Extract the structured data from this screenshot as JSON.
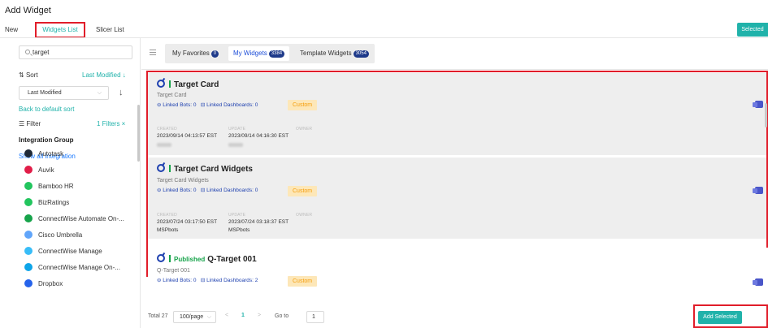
{
  "window": {
    "title": "Add Widget"
  },
  "top_tabs": [
    {
      "label": "New"
    },
    {
      "label": "Widgets List"
    },
    {
      "label": "Slicer List"
    }
  ],
  "selected_button": "Selected",
  "sidebar": {
    "search": {
      "value": "target",
      "placeholder": ""
    },
    "sort": {
      "label": "Sort",
      "current": "Last Modified ↓",
      "dropdown": "Last Modified",
      "reset_link": "Back to default sort"
    },
    "filter": {
      "label": "Filter",
      "count": "1 Filters ×"
    },
    "integration_group": {
      "heading": "Integration Group",
      "show_all": "Show all integration"
    },
    "integrations": [
      {
        "label": "Autotask",
        "color": "#1f2937"
      },
      {
        "label": "Auvik",
        "color": "#e11d48"
      },
      {
        "label": "Bamboo HR",
        "color": "#22c55e"
      },
      {
        "label": "BizRatings",
        "color": "#22c55e"
      },
      {
        "label": "ConnectWise Automate On-...",
        "color": "#16a34a"
      },
      {
        "label": "Cisco Umbrella",
        "color": "#60a5fa"
      },
      {
        "label": "ConnectWise Manage",
        "color": "#38bdf8"
      },
      {
        "label": "ConnectWise Manage On-...",
        "color": "#0ea5e9"
      },
      {
        "label": "Dropbox",
        "color": "#2563eb"
      }
    ]
  },
  "main": {
    "tabs": [
      {
        "label": "My Favorites",
        "badge": "0"
      },
      {
        "label": "My Widgets",
        "badge": "3384"
      },
      {
        "label": "Template Widgets",
        "badge": "3054"
      }
    ],
    "cards": [
      {
        "status": "",
        "title": "Target Card",
        "subtitle": "Target Card",
        "linked_bots": "⊖ Linked Bots: 0",
        "linked_dashboards": "⊟ Linked Dashboards: 0",
        "tag": "Custom",
        "created_label": "CREATED",
        "update_label": "UPDATE",
        "owner_label": "OWNER",
        "created": "2023/09/14 04:13:57 EST",
        "updated": "2023/09/14 04:16:30 EST",
        "created_by": "",
        "updated_by": ""
      },
      {
        "status": "",
        "title": "Target Card Widgets",
        "subtitle": "Target Card Widgets",
        "linked_bots": "⊖ Linked Bots: 0",
        "linked_dashboards": "⊟ Linked Dashboards: 0",
        "tag": "Custom",
        "created_label": "CREATED",
        "update_label": "UPDATE",
        "owner_label": "OWNER",
        "created": "2023/07/24 03:17:50 EST",
        "updated": "2023/07/24 03:18:37 EST",
        "created_by": "MSPbots",
        "updated_by": "MSPbots"
      },
      {
        "status": "Published",
        "title": "Q-Target 001",
        "subtitle": "Q-Target 001",
        "linked_bots": "⊖ Linked Bots: 0",
        "linked_dashboards": "⊟ Linked Dashboards: 2",
        "tag": "Custom"
      }
    ]
  },
  "footer": {
    "total": "Total 27",
    "page_size": "100/page",
    "prev": "<",
    "page": "1",
    "next": ">",
    "goto_label": "Go to",
    "goto_value": "1",
    "add_button": "Add Selected"
  },
  "colors": {
    "accent": "#20b2aa",
    "highlight": "#e11d2a",
    "badge": "#1e3a8a"
  }
}
